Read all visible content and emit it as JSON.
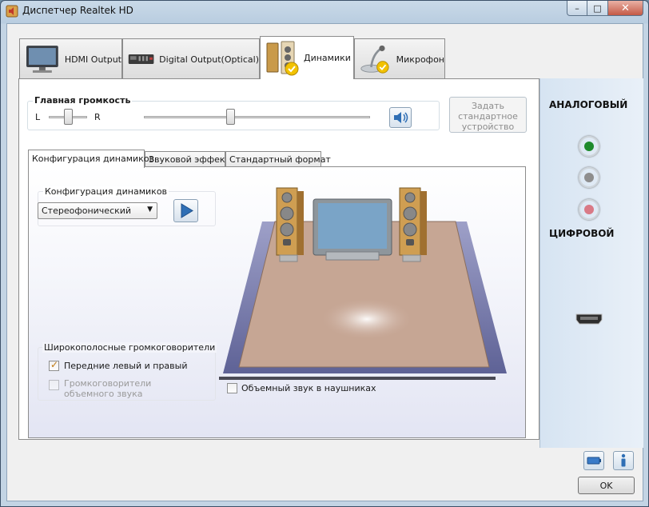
{
  "window": {
    "title": "Диспетчер Realtek HD",
    "controls": {
      "minimize": "–",
      "maximize": "□",
      "close": "✕"
    }
  },
  "device_tabs": [
    {
      "label": "HDMI Output",
      "icon": "monitor-icon"
    },
    {
      "label": "Digital Output(Optical)",
      "icon": "optical-device-icon"
    },
    {
      "label": "Динамики",
      "icon": "speakers-icon",
      "active": true
    },
    {
      "label": "Микрофон",
      "icon": "microphone-icon"
    }
  ],
  "volume": {
    "title": "Главная громкость",
    "left_label": "L",
    "right_label": "R",
    "balance_level": 0.5,
    "volume_level": 0.38
  },
  "default_device_button": "Задать стандартное устройство",
  "inner_tabs": [
    {
      "label": "Конфигурация динамиков",
      "active": true
    },
    {
      "label": "Звуковой эффект"
    },
    {
      "label": "Стандартный формат"
    }
  ],
  "speaker_config": {
    "title": "Конфигурация динамиков",
    "selected": "Стереофонический"
  },
  "wideband": {
    "title": "Широкополосные громкоговорители",
    "items": [
      {
        "label": "Передние левый и правый",
        "checked": true,
        "enabled": true
      },
      {
        "label": "Громкоговорители объемного звука",
        "checked": false,
        "enabled": false
      }
    ]
  },
  "headphones_surround": {
    "label": "Объемный звук в наушниках",
    "checked": false
  },
  "right_panel": {
    "analog_heading": "АНАЛОГОВЫЙ",
    "digital_heading": "ЦИФРОВОЙ",
    "jack_colors": [
      "#1e8a2c",
      "#8e8e8e",
      "#d97a86"
    ]
  },
  "buttons": {
    "ok": "OK"
  }
}
